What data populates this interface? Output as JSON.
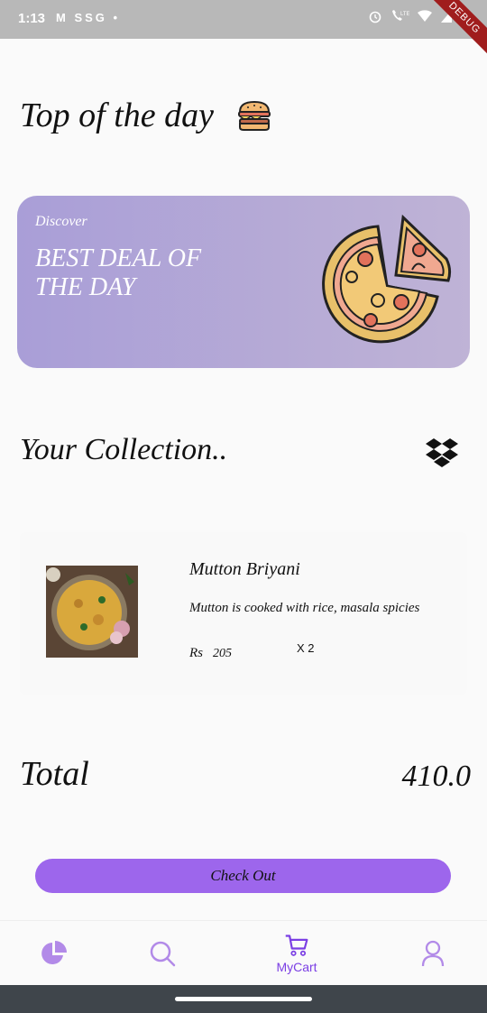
{
  "status_bar": {
    "time": "1:13",
    "left_icons": "M SSG •",
    "debug_label": "DEBUG"
  },
  "header": {
    "title": "Top of the day"
  },
  "banner": {
    "subtitle": "Discover",
    "headline": "BEST DEAL OF THE DAY"
  },
  "collection": {
    "title": "Your Collection.."
  },
  "cart": {
    "items": [
      {
        "name": "Mutton Briyani",
        "description": "Mutton is cooked with rice, masala spicies",
        "price_label": "Rs",
        "price": "205",
        "quantity": "X 2"
      }
    ]
  },
  "total": {
    "label": "Total",
    "value": "410.0"
  },
  "checkout": {
    "label": "Check Out"
  },
  "bottom_nav": {
    "items": [
      {
        "icon": "pie-chart-icon",
        "label": ""
      },
      {
        "icon": "search-icon",
        "label": ""
      },
      {
        "icon": "cart-icon",
        "label": "MyCart"
      },
      {
        "icon": "user-icon",
        "label": ""
      }
    ]
  },
  "colors": {
    "accent": "#9d66ec",
    "nav_icon": "#b28ae8",
    "banner_start": "#a99ed7",
    "banner_end": "#bfb3d6"
  }
}
